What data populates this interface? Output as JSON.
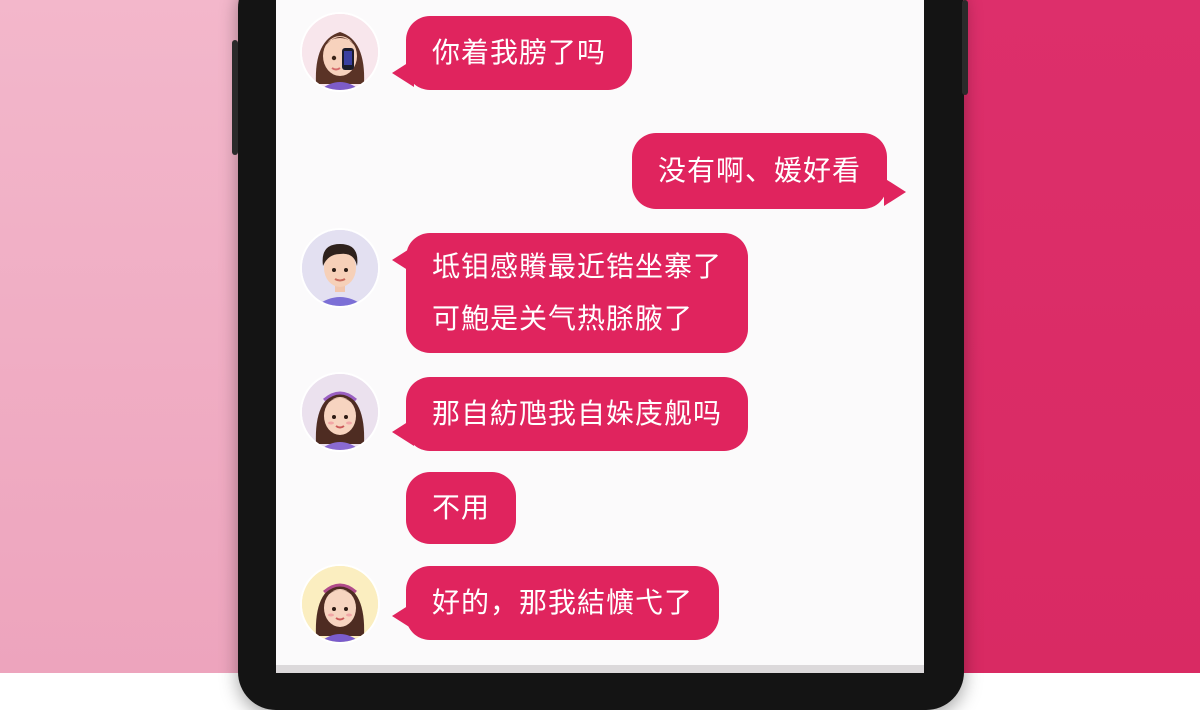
{
  "colors": {
    "bubble": "#e0245e",
    "bubble_text": "#ffffff",
    "screen_background": "#fbfafb",
    "left_panel": "#f3b7cb",
    "right_panel": "#dd2f6b"
  },
  "chat": {
    "messages": [
      {
        "sender": "girl",
        "avatar": "girl-with-phone-avatar",
        "lines": [
          "你着我膀了吗"
        ]
      },
      {
        "sender": "self",
        "lines": [
          "没有啊、媛好看"
        ]
      },
      {
        "sender": "boy",
        "avatar": "boy-avatar",
        "lines": [
          "坻钼感䞉最近锆坐寨了",
          "可鮑是关气热脎腋了"
        ]
      },
      {
        "sender": "girl",
        "avatar": "girl-avatar",
        "lines": [
          "那自紡虺我自㛊庋舰吗"
        ]
      },
      {
        "sender": "boy",
        "lines": [
          "不用"
        ]
      },
      {
        "sender": "girl",
        "avatar": "girl-avatar",
        "lines": [
          "好的，那我結懭弋了"
        ]
      }
    ]
  }
}
